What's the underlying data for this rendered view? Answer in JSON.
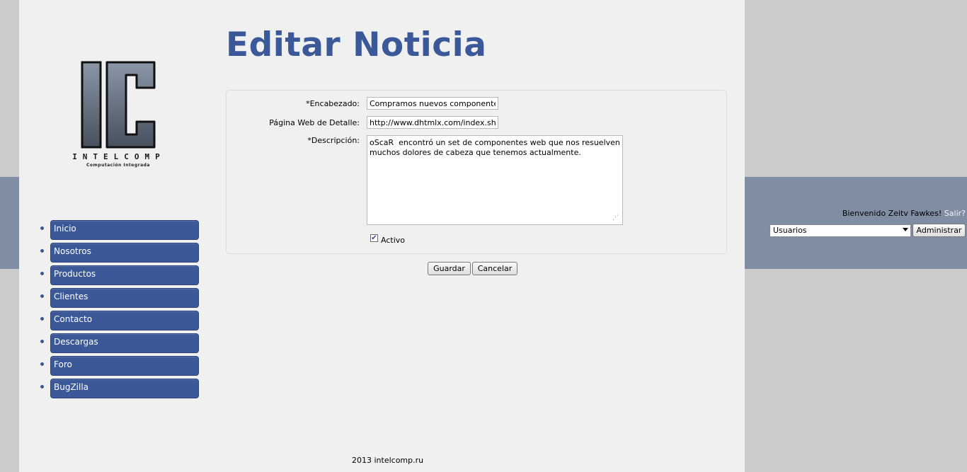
{
  "page": {
    "title": "Editar Noticia",
    "footer": "2013 intelcomp.ru"
  },
  "logo": {
    "letters": "IC",
    "brand": "INTELCOMP",
    "tagline": "Computación Integrada"
  },
  "nav": {
    "items": [
      {
        "label": "Inicio"
      },
      {
        "label": "Nosotros"
      },
      {
        "label": "Productos"
      },
      {
        "label": "Clientes"
      },
      {
        "label": "Contacto"
      },
      {
        "label": "Descargas"
      },
      {
        "label": "Foro"
      },
      {
        "label": "BugZilla"
      }
    ]
  },
  "form": {
    "headline_label": "*Encabezado:",
    "headline_value": "Compramos nuevos componentes web",
    "url_label": "Página Web de Detalle:",
    "url_value": "http://www.dhtmlx.com/index.shtml",
    "description_label": "*Descripción:",
    "description_value": "oScaR  encontró un set de componentes web que nos resuelven muchos dolores de cabeza que tenemos actualmente.",
    "active_label": "Activo",
    "active_checked": true,
    "save_label": "Guardar",
    "cancel_label": "Cancelar"
  },
  "user_panel": {
    "welcome_text": "Bienvenido Zeitv Fawkes!",
    "logout_label": "Salir?",
    "select_value": "Usuarios",
    "admin_button": "Administrar"
  },
  "colors": {
    "accent": "#3b5899",
    "band": "#7f8ea3",
    "page_bg": "#f0f0f0",
    "outer_bg": "#cbcbcb"
  }
}
